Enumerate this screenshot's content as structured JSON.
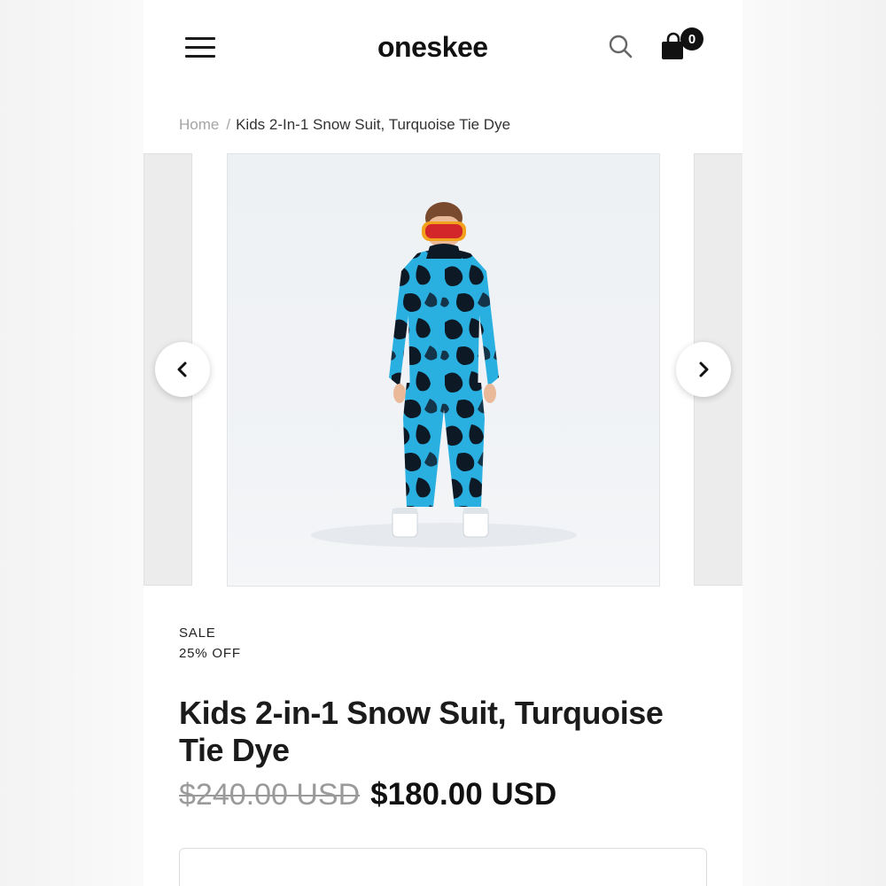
{
  "header": {
    "logo": "oneskee",
    "cart_count": "0"
  },
  "breadcrumb": {
    "home": "Home",
    "separator": "/",
    "current": "Kids 2-In-1 Snow Suit, Turquoise Tie Dye"
  },
  "product": {
    "sale_label": "SALE",
    "discount": "25% OFF",
    "title": "Kids 2-in-1 Snow Suit, Turquoise Tie Dye",
    "price_original": "$240.00 USD",
    "price_sale": "$180.00 USD",
    "suit_color": "#2ab0e0"
  }
}
